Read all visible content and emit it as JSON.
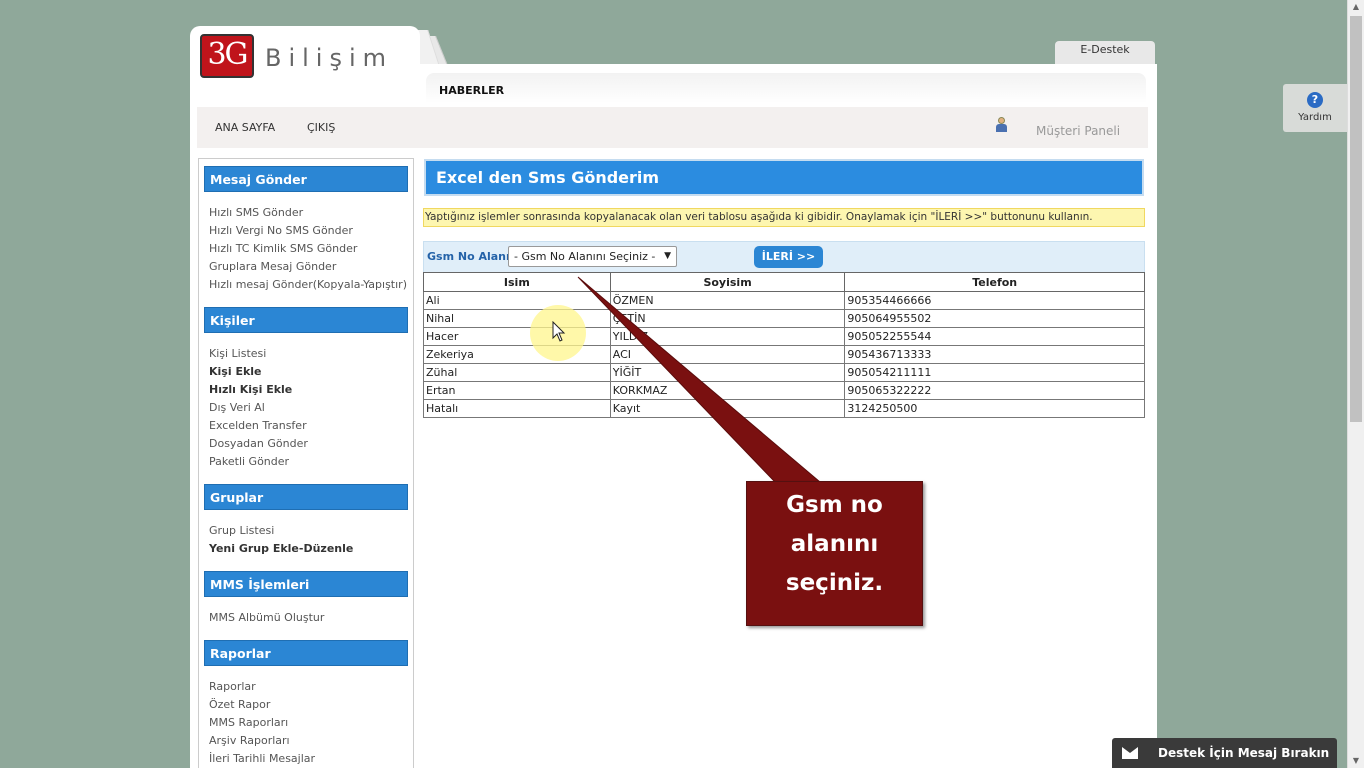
{
  "brand": {
    "logo_mark": "3G",
    "logo_text": "Bilişim"
  },
  "top_tab": {
    "label": "E-Destek"
  },
  "news": {
    "label": "HABERLER"
  },
  "nav": {
    "home": "ANA SAYFA",
    "logout": "ÇIKIŞ",
    "panel": "Müşteri Paneli"
  },
  "help": {
    "label": "Yardım",
    "icon": "question-icon"
  },
  "sidebar": {
    "sections": [
      {
        "title": "Mesaj Gönder",
        "items": [
          "Hızlı SMS Gönder",
          "Hızlı Vergi No SMS Gönder",
          "Hızlı TC Kimlik SMS Gönder",
          "Gruplara Mesaj Gönder",
          "Hızlı mesaj Gönder(Kopyala-Yapıştır)"
        ]
      },
      {
        "title": "Kişiler",
        "items": [
          "Kişi Listesi",
          "Kişi Ekle",
          "Hızlı Kişi Ekle",
          "Dış Veri Al",
          "Excelden Transfer",
          "Dosyadan Gönder",
          "Paketli Gönder"
        ]
      },
      {
        "title": "Gruplar",
        "items": [
          "Grup Listesi",
          "Yeni Grup Ekle-Düzenle"
        ]
      },
      {
        "title": "MMS İşlemleri",
        "items": [
          "MMS Albümü Oluştur"
        ]
      },
      {
        "title": "Raporlar",
        "items": [
          "Raporlar",
          "Özet Rapor",
          "MMS Raporları",
          "Arşiv Raporları",
          "İleri Tarihli Mesajlar"
        ]
      }
    ]
  },
  "main": {
    "title": "Excel den Sms Gönderim",
    "info": "Yaptığınız işlemler sonrasında kopyalanacak olan veri tablosu aşağıda ki gibidir. Onaylamak için \"İLERİ >>\" buttonunu kullanın.",
    "gsm_label": "Gsm No Alanı:",
    "gsm_select": "- Gsm No Alanını Seçiniz -",
    "next_button": "İLERİ >>",
    "table": {
      "headers": [
        "Isim",
        "Soyisim",
        "Telefon"
      ],
      "rows": [
        [
          "Ali",
          "ÖZMEN",
          "905354466666"
        ],
        [
          "Nihal",
          "ÇETİN",
          "905064955502"
        ],
        [
          "Hacer",
          "YILDIZ",
          "905052255544"
        ],
        [
          "Zekeriya",
          "ACI",
          "905436713333"
        ],
        [
          "Zühal",
          "YİĞİT",
          "905054211111"
        ],
        [
          "Ertan",
          "KORKMAZ",
          "905065322222"
        ],
        [
          "Hatalı",
          "Kayıt",
          "3124250500"
        ]
      ]
    }
  },
  "callout": {
    "lines": [
      "Gsm no",
      "alanını",
      "seçiniz."
    ],
    "color": "#7a1010"
  },
  "footer": {
    "destek": "Destek İçin Mesaj Bırakın"
  }
}
